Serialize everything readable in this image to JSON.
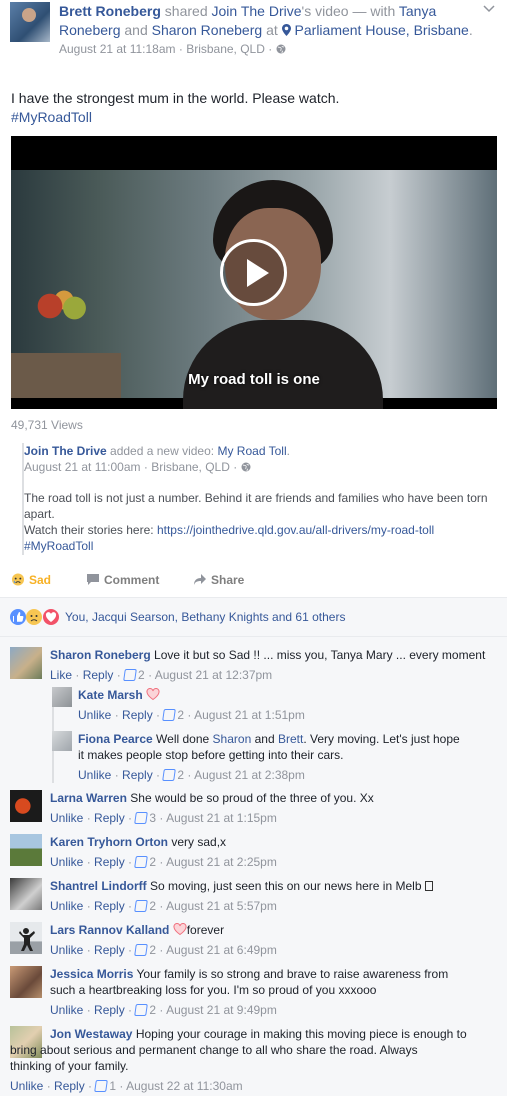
{
  "header": {
    "author": "Brett Roneberg",
    "shared_word": "shared",
    "source_page": "Join The Drive",
    "source_suffix": "'s video",
    "with_text": "— with",
    "tagged_1": "Tanya Roneberg",
    "and_text": "and",
    "tagged_2": "Sharon Roneberg",
    "at_text": "at",
    "place": "Parliament House, Brisbane",
    "place_suffix": ".",
    "timestamp": "August 21 at 11:18am · Brisbane, QLD ·"
  },
  "post": {
    "text": "I have the strongest mum in the world. Please watch.",
    "hashtag": "#MyRoadToll"
  },
  "video": {
    "caption": "My road toll is one",
    "views": "49,731 Views"
  },
  "shared_post": {
    "page": "Join The Drive",
    "action": "added a new video:",
    "video_title": "My Road Toll",
    "period": ".",
    "timestamp": "August 21 at 11:00am · Brisbane, QLD ·",
    "text_1": "The road toll is not just a number. Behind it are friends and families who have been torn apart.",
    "text_2_prefix": "Watch their stories here:",
    "link": "https://jointhedrive.qld.gov.au/all-drivers/my-road-toll",
    "hashtag": "#MyRoadToll"
  },
  "actions": {
    "sad": "Sad",
    "comment": "Comment",
    "share": "Share"
  },
  "reactions": {
    "names": "You, Jacqui Searson, Bethany Knights and 61 others",
    "icons": [
      "like-icon",
      "sad-icon",
      "love-icon"
    ]
  },
  "comments": [
    {
      "name": "Sharon Roneberg",
      "text": "Love it but so Sad !! ... miss you, Tanya Mary ... every moment",
      "like_label": "Like",
      "reply_label": "Reply",
      "likes": "2",
      "time": "August 21 at 12:37pm",
      "replies": [
        {
          "name": "Kate Marsh",
          "text": "",
          "like_label": "Unlike",
          "reply_label": "Reply",
          "likes": "2",
          "time": "August 21 at 1:51pm"
        },
        {
          "name": "Fiona Pearce",
          "text_1": "Well done",
          "mention_1": "Sharon",
          "and": "and",
          "mention_2": "Brett",
          "text_2": ". Very moving. Let's just hope",
          "text_3": "it makes people stop before getting into their cars.",
          "like_label": "Unlike",
          "reply_label": "Reply",
          "likes": "2",
          "time": "August 21 at 2:38pm"
        }
      ]
    },
    {
      "name": "Larna Warren",
      "text": "She would be so proud of the three of you. Xx",
      "like_label": "Unlike",
      "reply_label": "Reply",
      "likes": "3",
      "time": "August 21 at 1:15pm"
    },
    {
      "name": "Karen Tryhorn Orton",
      "text": "very sad,x",
      "like_label": "Unlike",
      "reply_label": "Reply",
      "likes": "2",
      "time": "August 21 at 2:25pm"
    },
    {
      "name": "Shantrel Lindorff",
      "text": "So moving, just seen this on our news here in Melb",
      "like_label": "Unlike",
      "reply_label": "Reply",
      "likes": "2",
      "time": "August 21 at 5:57pm"
    },
    {
      "name": "Lars Rannov Kalland",
      "text": "forever",
      "like_label": "Unlike",
      "reply_label": "Reply",
      "likes": "2",
      "time": "August 21 at 6:49pm"
    },
    {
      "name": "Jessica Morris",
      "text_1": "Your family is so strong and brave to raise awareness from",
      "text_2": "such a heartbreaking loss for you. I'm so proud of you xxxooo",
      "like_label": "Unlike",
      "reply_label": "Reply",
      "likes": "2",
      "time": "August 21 at 9:49pm"
    },
    {
      "name": "Jon Westaway",
      "text_1": "Hoping your courage in making this moving piece is enough to",
      "text_2": "bring about serious and permanent change to all who share the road. Always",
      "text_3": "thinking of your family.",
      "like_label": "Unlike",
      "reply_label": "Reply",
      "likes": "1",
      "time": "August 22 at 11:30am"
    }
  ]
}
